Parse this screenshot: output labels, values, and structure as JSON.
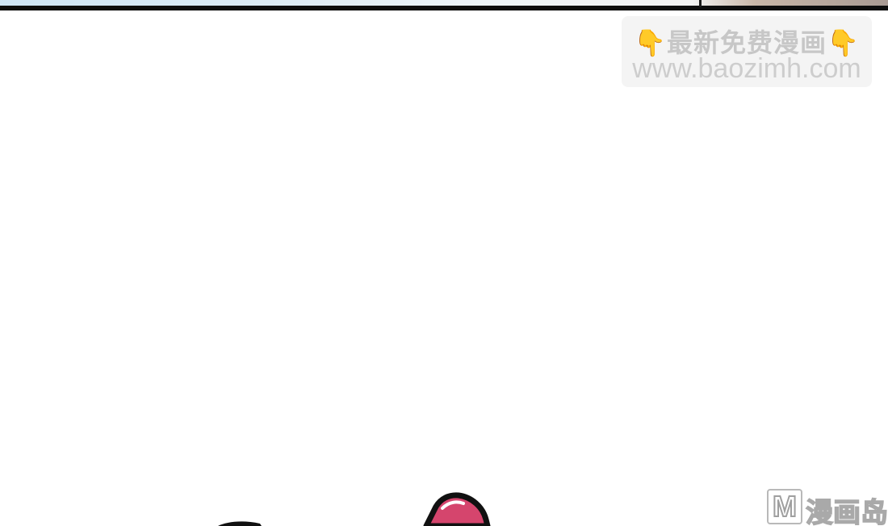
{
  "watermark": {
    "finger_left": "👇",
    "title": "最新免费漫画",
    "finger_right": "👇",
    "url": "www.baozimh.com"
  },
  "logo": {
    "letter": "M",
    "name": "漫画岛"
  },
  "colors": {
    "finger": "#f3b33a",
    "watermark_text": "#c7c7c7",
    "ear_fill": "#d5456d",
    "outline": "#111111"
  }
}
